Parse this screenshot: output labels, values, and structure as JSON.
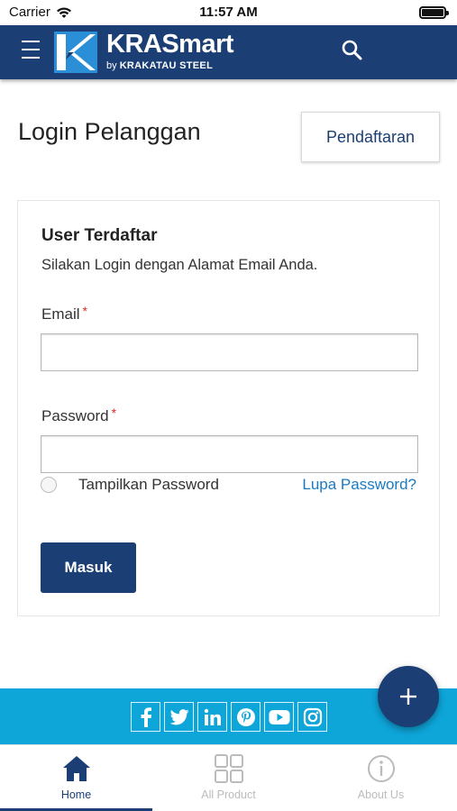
{
  "status_bar": {
    "carrier": "Carrier",
    "time": "11:57 AM"
  },
  "header": {
    "brand_name": "KRASmart",
    "brand_by": "by",
    "brand_company": "KRAKATAU STEEL",
    "icons": {
      "menu": "hamburger-menu-icon",
      "search": "search-icon"
    }
  },
  "page": {
    "title": "Login Pelanggan",
    "register_label": "Pendaftaran"
  },
  "login_form": {
    "section_title": "User Terdaftar",
    "section_desc": "Silakan Login dengan Alamat Email Anda.",
    "email_label": "Email",
    "email_value": "",
    "password_label": "Password",
    "password_value": "",
    "required_mark": "*",
    "show_password_label": "Tampilkan Password",
    "show_password_checked": false,
    "forgot_password_label": "Lupa Password?",
    "submit_label": "Masuk"
  },
  "social": {
    "icons": [
      "facebook-icon",
      "twitter-icon",
      "linkedin-icon",
      "pinterest-icon",
      "youtube-icon",
      "instagram-icon"
    ]
  },
  "fab": {
    "icon": "plus-icon"
  },
  "bottom_nav": {
    "items": [
      {
        "label": "Home",
        "icon": "home-icon",
        "active": true
      },
      {
        "label": "All Product",
        "icon": "grid-icon",
        "active": false
      },
      {
        "label": "About Us",
        "icon": "info-icon",
        "active": false
      }
    ]
  },
  "colors": {
    "primary": "#1b3f74",
    "accent_band": "#0ea5d9",
    "link": "#1979c3",
    "required": "#e02b27",
    "inactive": "#bbbbbb"
  }
}
